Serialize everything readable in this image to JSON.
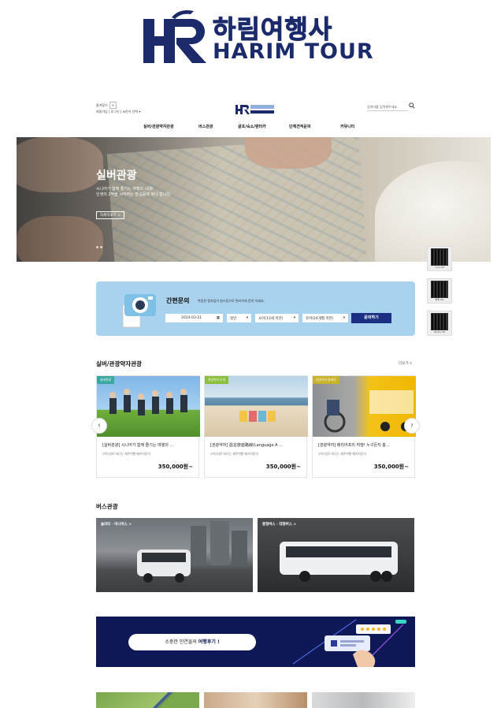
{
  "brand": {
    "logo_ko": "하림여행사",
    "logo_en": "HARIM TOUR",
    "colors": {
      "navy": "#1b2a6b",
      "accent_blue": "#1b2f83",
      "banner": "#0f1857",
      "inquiry_bg": "#a9d2ee"
    }
  },
  "header": {
    "bookmark": "즐겨찾기",
    "join": "회원가입",
    "login": "로그인",
    "lang": "언어 선택",
    "search_placeholder": "검색어를 입력해주세요.",
    "nav": [
      "실버/관광약자관광",
      "버스관광",
      "골프/숙소/렌터카",
      "단체견적문의",
      "커뮤니티"
    ]
  },
  "hero": {
    "title": "실버관광",
    "line1": "시니어가 함께 즐기는 여행의 시대!",
    "line2": "인생의 2막을 시작하는 발걸음에 하나 합니다.",
    "more": "자세히보기 >"
  },
  "qr": [
    {
      "label": "Line QR"
    },
    {
      "label": "톡톡 QR"
    },
    {
      "label": "Whats QR"
    }
  ],
  "inquiry": {
    "title": "간편문의",
    "desc": "복잡한 절차없이 원스탑으로 편리하게 문의 하세요.",
    "date": "2024-03-21",
    "adult": "성인",
    "child": "소아(13세 미만)",
    "infant": "유아(24개월 미만)",
    "button": "문의하기"
  },
  "silver": {
    "title": "실버/관광약자관광",
    "more": "더보기 +",
    "cards": [
      {
        "badge": "실버관광",
        "badge_color": "#3aa8a0",
        "name": "[실버관광] 시니어가 함께 즐기는 여행의 ...",
        "sub": "2박3일로 떠나는 제주여행 패키지투어",
        "price": "350,000원~"
      },
      {
        "badge": "관광약자 안내",
        "badge_color": "#8bbf3c",
        "name": "[관광약자] 語言旅遊路線(Language A ...",
        "sub": "2박3일로 떠나는 제주여행 패키지투어",
        "price": "350,000원~"
      },
      {
        "badge": "관광약자 장애인",
        "badge_color": "#c8b22a",
        "name": "[관광약자] 배리어프리 여행! 누구든지 충...",
        "sub": "2박3일로 떠나는 제주여행 패키지투어",
        "price": "350,000원~"
      }
    ]
  },
  "bus": {
    "title": "버스관광",
    "items": [
      {
        "label": "솔라티 · 미니버스 >"
      },
      {
        "label": "중형버스 · 대형버스 >"
      }
    ]
  },
  "review": {
    "text_a": "소중한 인연들의 ",
    "text_b": "여행후기 !"
  }
}
